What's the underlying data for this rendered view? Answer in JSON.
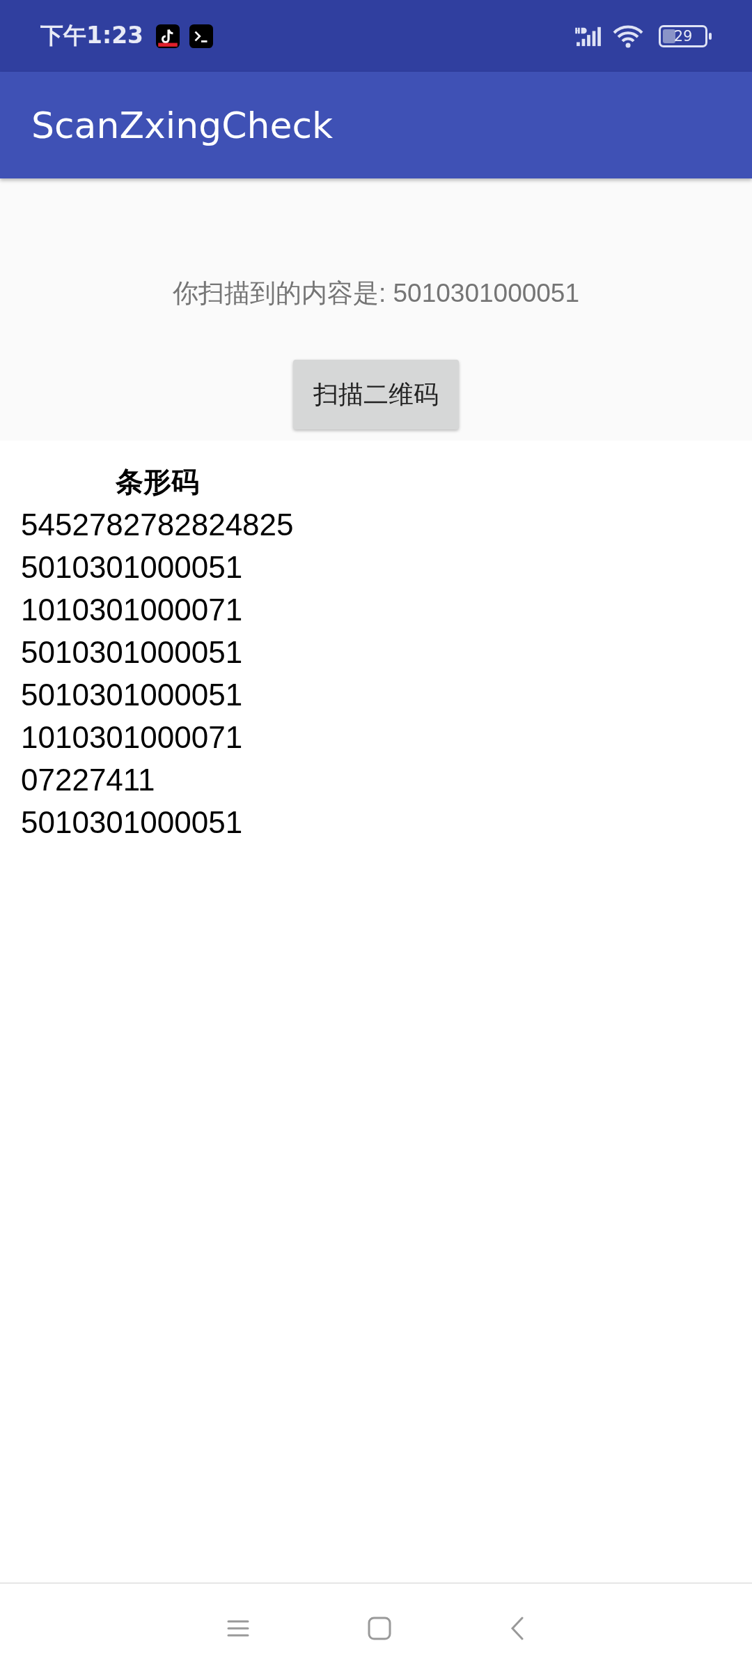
{
  "status_bar": {
    "time": "下午1:23",
    "battery": "29"
  },
  "app_bar": {
    "title": "ScanZxingCheck"
  },
  "scan_result": {
    "label": "你扫描到的内容是: 5010301000051"
  },
  "scan_button": {
    "label": "扫描二维码"
  },
  "table": {
    "column_header": "条形码",
    "rows": [
      "5452782782824825",
      "5010301000051",
      "1010301000071",
      "5010301000051",
      "5010301000051",
      "1010301000071",
      "07227411",
      "5010301000051"
    ]
  }
}
